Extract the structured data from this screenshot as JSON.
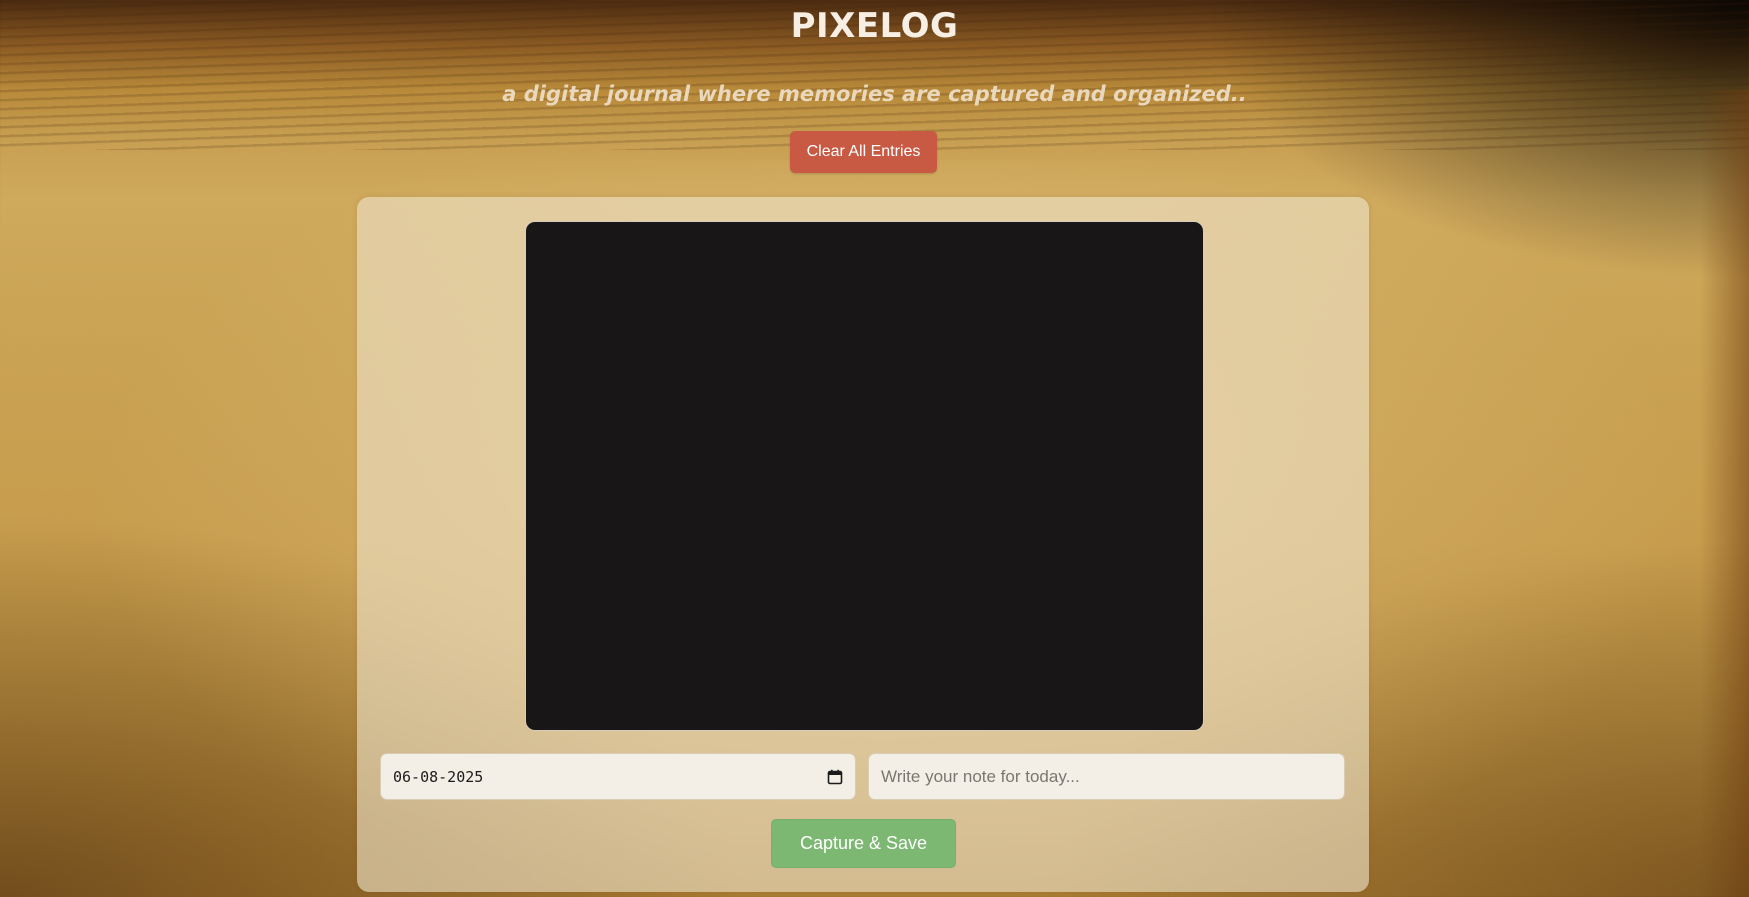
{
  "header": {
    "title": "PIXELOG",
    "subtitle": "a digital journal where memories are captured and organized.."
  },
  "actions": {
    "clear_label": "Clear All Entries",
    "save_label": "Capture & Save"
  },
  "form": {
    "date_value": "06-08-2025",
    "note_placeholder": "Write your note for today...",
    "note_value": ""
  },
  "icons": {
    "calendar": "calendar-icon"
  },
  "colors": {
    "clear_button": "#c85a44",
    "save_button": "#7db873",
    "camera_bg": "#191617"
  }
}
